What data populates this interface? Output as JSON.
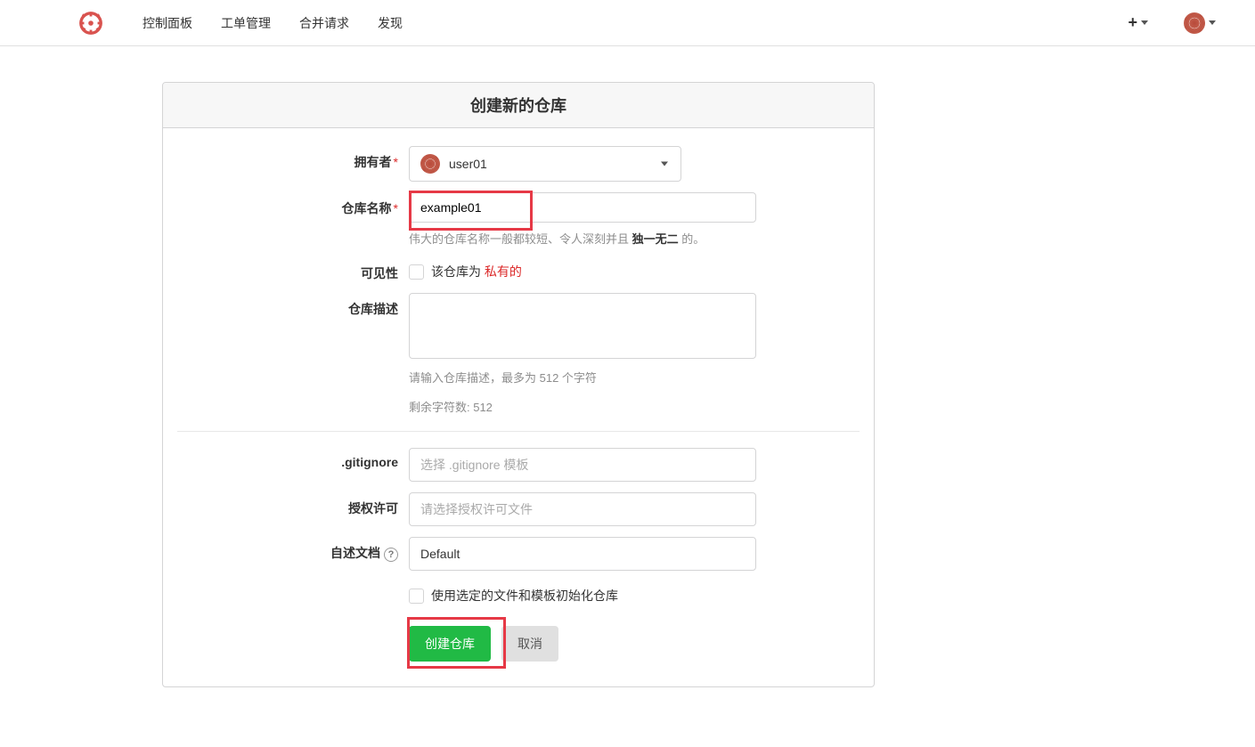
{
  "nav": {
    "items": [
      "控制面板",
      "工单管理",
      "合并请求",
      "发现"
    ]
  },
  "panel": {
    "title": "创建新的仓库"
  },
  "form": {
    "owner": {
      "label": "拥有者",
      "value": "user01"
    },
    "name": {
      "label": "仓库名称",
      "value": "example01",
      "help_prefix": "伟大的仓库名称一般都较短、令人深刻并且 ",
      "help_em": "独一无二",
      "help_suffix": " 的。"
    },
    "visibility": {
      "label": "可见性",
      "checkbox_text_prefix": "该仓库为 ",
      "checkbox_text_private": "私有的"
    },
    "description": {
      "label": "仓库描述",
      "help": "请输入仓库描述，最多为 512 个字符",
      "chars_left": "剩余字符数: 512"
    },
    "gitignore": {
      "label": ".gitignore",
      "placeholder": "选择 .gitignore 模板"
    },
    "license": {
      "label": "授权许可",
      "placeholder": "请选择授权许可文件"
    },
    "readme": {
      "label": "自述文档",
      "value": "Default"
    },
    "init": {
      "checkbox_text": "使用选定的文件和模板初始化仓库"
    },
    "buttons": {
      "submit": "创建仓库",
      "cancel": "取消"
    }
  }
}
